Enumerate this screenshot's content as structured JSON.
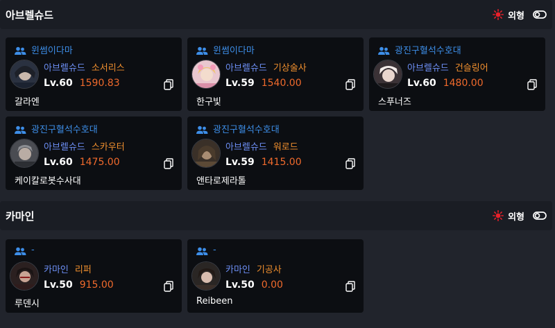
{
  "sections": [
    {
      "title": "아브렐슈드",
      "appearance_label": "외형",
      "cards": [
        {
          "guild": "윈썸이다마",
          "server": "아브렐슈드",
          "class": "소서리스",
          "level": "Lv.60",
          "score": "1590.83",
          "name": "갈라엔"
        },
        {
          "guild": "윈썸이다마",
          "server": "아브렐슈드",
          "class": "기상술사",
          "level": "Lv.59",
          "score": "1540.00",
          "name": "한구빛"
        },
        {
          "guild": "광진구혈석수호대",
          "server": "아브렐슈드",
          "class": "건슬링어",
          "level": "Lv.60",
          "score": "1480.00",
          "name": "스푸너즈"
        },
        {
          "guild": "광진구혈석수호대",
          "server": "아브렐슈드",
          "class": "스카우터",
          "level": "Lv.60",
          "score": "1475.00",
          "name": "케이칼로봇수사대"
        },
        {
          "guild": "광진구혈석수호대",
          "server": "아브렐슈드",
          "class": "워로드",
          "level": "Lv.59",
          "score": "1415.00",
          "name": "앤타로제라톨"
        }
      ]
    },
    {
      "title": "카마인",
      "appearance_label": "외형",
      "cards": [
        {
          "guild": "-",
          "server": "카마인",
          "class": "리퍼",
          "level": "Lv.50",
          "score": "915.00",
          "name": "루덴시"
        },
        {
          "guild": "-",
          "server": "카마인",
          "class": "기공사",
          "level": "Lv.50",
          "score": "0.00",
          "name": "Reibeen"
        }
      ]
    }
  ],
  "colors": {
    "guild": "#3d8ee8",
    "server": "#6d8ff5",
    "class": "#f08f2e",
    "score": "#f06a2c",
    "sun": "#e8202a"
  },
  "icons": {
    "guild": "people-icon",
    "appearance": "sun-icon",
    "toggle": "toggle-icon",
    "copy": "copy-icon"
  }
}
